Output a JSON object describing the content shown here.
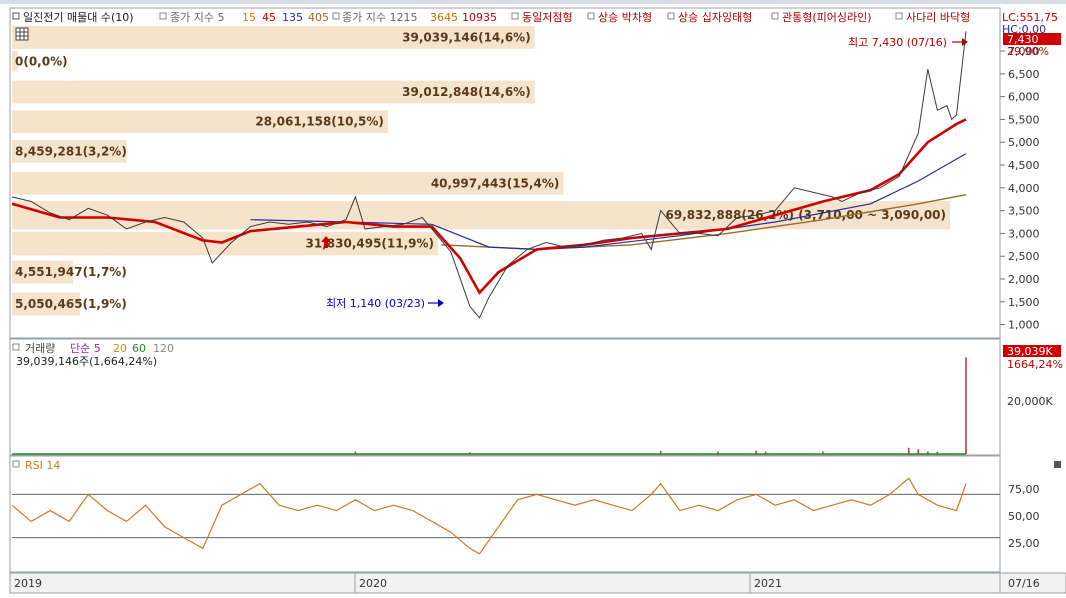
{
  "legend": {
    "title": "일진전기 매물대 수(10)",
    "ma_label": "종가 지수 5",
    "ma_periods": [
      {
        "text": "15",
        "color": "#e07800"
      },
      {
        "text": "45",
        "color": "#d00000"
      },
      {
        "text": "135",
        "color": "#1f2f9f"
      },
      {
        "text": "405",
        "color": "#9a6a2a"
      }
    ],
    "ma2_label": "종가 지수 1215",
    "ma2_periods": [
      {
        "text": "3645",
        "color": "#c07000"
      },
      {
        "text": "10935",
        "color": "#c00000"
      }
    ],
    "patterns": [
      "동일저점형",
      "상승 박차형",
      "상승 십자잉태형",
      "관통형(피어싱라인)",
      "사다리 바닥형"
    ]
  },
  "top_right": {
    "lc": "LC:551,75",
    "hc": "HC:0,00"
  },
  "price_axis": {
    "ticks": [
      "7,000",
      "6,500",
      "6,000",
      "5,500",
      "5,000",
      "4,500",
      "4,000",
      "3,500",
      "3,000",
      "2,500",
      "2,000",
      "1,500",
      "1,000"
    ],
    "current_price": "7,430",
    "current_change": "29,90%"
  },
  "annotations": {
    "high": "최고 7,430 (07/16)",
    "low": "최저 1,140 (03/23)"
  },
  "volume_panel": {
    "legend": {
      "title": "거래량",
      "ma": "단순 5",
      "periods": [
        "20",
        "60",
        "120"
      ]
    },
    "value_text": "39,039,146주(1,664,24%)",
    "axis_tick": "20,000K",
    "current_volume": "39,039K",
    "current_change": "1664,24%"
  },
  "rsi_panel": {
    "legend": "RSI 14",
    "ticks": [
      "75,00",
      "50,00",
      "25,00"
    ]
  },
  "date_axis": {
    "labels": [
      "2019",
      "2020",
      "2021"
    ],
    "end_label": "07/16"
  },
  "colors": {
    "price_line": "#3a3a3a",
    "ma15": "#e07800",
    "ma45": "#d00000",
    "ma135": "#1f2f9f",
    "ma405": "#9a6a2a",
    "rsi": "#d07a20",
    "volume_bar": "#b04040",
    "volume_profile": "#f6e3cc",
    "accent_red": "#d00000",
    "low_blue": "#0000c0"
  },
  "chart_data": {
    "type": "line",
    "price_range": [
      750,
      7900
    ],
    "volume_profile": [
      {
        "label": "39,039,146(14,6%)",
        "low": 7050,
        "high": 7550,
        "pct": 14.6
      },
      {
        "label": "0(0,0%)",
        "low": 6550,
        "high": 7000,
        "pct": 0.0
      },
      {
        "label": "39,012,848(14,6%)",
        "low": 5850,
        "high": 6350,
        "pct": 14.6
      },
      {
        "label": "28,061,158(10,5%)",
        "low": 5200,
        "high": 5700,
        "pct": 10.5
      },
      {
        "label": "8,459,281(3,2%)",
        "low": 4550,
        "high": 5050,
        "pct": 3.2
      },
      {
        "label": "40,997,443(15,4%)",
        "low": 3850,
        "high": 4350,
        "pct": 15.4
      },
      {
        "label": "69,832,888(26,2%) (3,710,00 ~ 3,090,00)",
        "low": 3090,
        "high": 3710,
        "pct": 26.2
      },
      {
        "label": "31,830,495(11,9%)",
        "low": 2520,
        "high": 3030,
        "pct": 11.9
      },
      {
        "label": "4,551,947(1,7%)",
        "low": 1900,
        "high": 2400,
        "pct": 1.7
      },
      {
        "label": "5,050,465(1,9%)",
        "low": 1200,
        "high": 1700,
        "pct": 1.9
      }
    ],
    "price_points": [
      [
        0,
        3800
      ],
      [
        0.02,
        3700
      ],
      [
        0.04,
        3450
      ],
      [
        0.06,
        3300
      ],
      [
        0.08,
        3550
      ],
      [
        0.1,
        3400
      ],
      [
        0.12,
        3100
      ],
      [
        0.14,
        3250
      ],
      [
        0.16,
        3350
      ],
      [
        0.18,
        3250
      ],
      [
        0.2,
        2900
      ],
      [
        0.21,
        2350
      ],
      [
        0.23,
        2800
      ],
      [
        0.25,
        3150
      ],
      [
        0.27,
        3250
      ],
      [
        0.29,
        3200
      ],
      [
        0.31,
        3250
      ],
      [
        0.33,
        3150
      ],
      [
        0.35,
        3300
      ],
      [
        0.36,
        3800
      ],
      [
        0.37,
        3100
      ],
      [
        0.39,
        3150
      ],
      [
        0.41,
        3200
      ],
      [
        0.43,
        3350
      ],
      [
        0.44,
        3100
      ],
      [
        0.46,
        2600
      ],
      [
        0.48,
        1400
      ],
      [
        0.49,
        1150
      ],
      [
        0.5,
        1600
      ],
      [
        0.52,
        2300
      ],
      [
        0.54,
        2650
      ],
      [
        0.56,
        2800
      ],
      [
        0.58,
        2700
      ],
      [
        0.6,
        2750
      ],
      [
        0.62,
        2850
      ],
      [
        0.64,
        2900
      ],
      [
        0.66,
        3000
      ],
      [
        0.67,
        2650
      ],
      [
        0.68,
        3500
      ],
      [
        0.7,
        3000
      ],
      [
        0.72,
        3000
      ],
      [
        0.74,
        2950
      ],
      [
        0.76,
        3350
      ],
      [
        0.78,
        3400
      ],
      [
        0.8,
        3500
      ],
      [
        0.82,
        4000
      ],
      [
        0.84,
        3900
      ],
      [
        0.86,
        3800
      ],
      [
        0.87,
        3700
      ],
      [
        0.89,
        3900
      ],
      [
        0.91,
        4000
      ],
      [
        0.93,
        4250
      ],
      [
        0.95,
        5200
      ],
      [
        0.96,
        6600
      ],
      [
        0.97,
        5700
      ],
      [
        0.98,
        5800
      ],
      [
        0.985,
        5500
      ],
      [
        0.99,
        5600
      ],
      [
        1.0,
        7430
      ]
    ],
    "ma45_points": [
      [
        0,
        3650
      ],
      [
        0.05,
        3350
      ],
      [
        0.1,
        3350
      ],
      [
        0.15,
        3250
      ],
      [
        0.2,
        2850
      ],
      [
        0.22,
        2800
      ],
      [
        0.25,
        3050
      ],
      [
        0.3,
        3150
      ],
      [
        0.35,
        3250
      ],
      [
        0.4,
        3150
      ],
      [
        0.44,
        3150
      ],
      [
        0.47,
        2450
      ],
      [
        0.49,
        1700
      ],
      [
        0.51,
        2150
      ],
      [
        0.55,
        2650
      ],
      [
        0.6,
        2750
      ],
      [
        0.65,
        2900
      ],
      [
        0.7,
        3000
      ],
      [
        0.75,
        3100
      ],
      [
        0.8,
        3400
      ],
      [
        0.85,
        3700
      ],
      [
        0.9,
        3950
      ],
      [
        0.93,
        4300
      ],
      [
        0.96,
        5000
      ],
      [
        0.99,
        5400
      ],
      [
        1.0,
        5500
      ]
    ],
    "ma135_points": [
      [
        0.25,
        3300
      ],
      [
        0.35,
        3250
      ],
      [
        0.44,
        3200
      ],
      [
        0.5,
        2700
      ],
      [
        0.55,
        2650
      ],
      [
        0.6,
        2700
      ],
      [
        0.7,
        2950
      ],
      [
        0.8,
        3250
      ],
      [
        0.9,
        3650
      ],
      [
        0.95,
        4150
      ],
      [
        1.0,
        4750
      ]
    ],
    "ma405_points": [
      [
        0.45,
        2750
      ],
      [
        0.55,
        2650
      ],
      [
        0.65,
        2750
      ],
      [
        0.75,
        3000
      ],
      [
        0.85,
        3300
      ],
      [
        0.95,
        3650
      ],
      [
        1.0,
        3850
      ]
    ],
    "volume_points": [
      [
        0.36,
        1.0
      ],
      [
        0.48,
        0.7
      ],
      [
        0.68,
        1.2
      ],
      [
        0.74,
        1.0
      ],
      [
        0.78,
        1.3
      ],
      [
        0.79,
        1.0
      ],
      [
        0.85,
        1.0
      ],
      [
        0.94,
        2.5
      ],
      [
        0.95,
        1.9
      ],
      [
        0.96,
        1.0
      ],
      [
        0.97,
        0.8
      ],
      [
        1.0,
        39.0
      ]
    ],
    "volume_range": [
      0,
      42
    ],
    "rsi_points": [
      [
        0,
        60
      ],
      [
        0.02,
        45
      ],
      [
        0.04,
        55
      ],
      [
        0.06,
        45
      ],
      [
        0.08,
        70
      ],
      [
        0.1,
        55
      ],
      [
        0.12,
        45
      ],
      [
        0.14,
        60
      ],
      [
        0.16,
        40
      ],
      [
        0.18,
        30
      ],
      [
        0.2,
        20
      ],
      [
        0.22,
        60
      ],
      [
        0.24,
        70
      ],
      [
        0.26,
        80
      ],
      [
        0.28,
        60
      ],
      [
        0.3,
        55
      ],
      [
        0.32,
        60
      ],
      [
        0.34,
        55
      ],
      [
        0.36,
        65
      ],
      [
        0.38,
        55
      ],
      [
        0.4,
        60
      ],
      [
        0.42,
        55
      ],
      [
        0.44,
        45
      ],
      [
        0.46,
        35
      ],
      [
        0.48,
        20
      ],
      [
        0.49,
        15
      ],
      [
        0.51,
        40
      ],
      [
        0.53,
        65
      ],
      [
        0.55,
        70
      ],
      [
        0.57,
        65
      ],
      [
        0.59,
        60
      ],
      [
        0.61,
        65
      ],
      [
        0.63,
        60
      ],
      [
        0.65,
        55
      ],
      [
        0.67,
        70
      ],
      [
        0.68,
        80
      ],
      [
        0.7,
        55
      ],
      [
        0.72,
        60
      ],
      [
        0.74,
        55
      ],
      [
        0.76,
        65
      ],
      [
        0.78,
        70
      ],
      [
        0.8,
        60
      ],
      [
        0.82,
        65
      ],
      [
        0.84,
        55
      ],
      [
        0.86,
        60
      ],
      [
        0.88,
        65
      ],
      [
        0.9,
        60
      ],
      [
        0.92,
        70
      ],
      [
        0.94,
        85
      ],
      [
        0.95,
        70
      ],
      [
        0.97,
        60
      ],
      [
        0.99,
        55
      ],
      [
        1.0,
        80
      ]
    ],
    "rsi_range": [
      0,
      100
    ],
    "rsi_levels": [
      70,
      30
    ],
    "dates": [
      "2019",
      "2020",
      "2021"
    ]
  }
}
